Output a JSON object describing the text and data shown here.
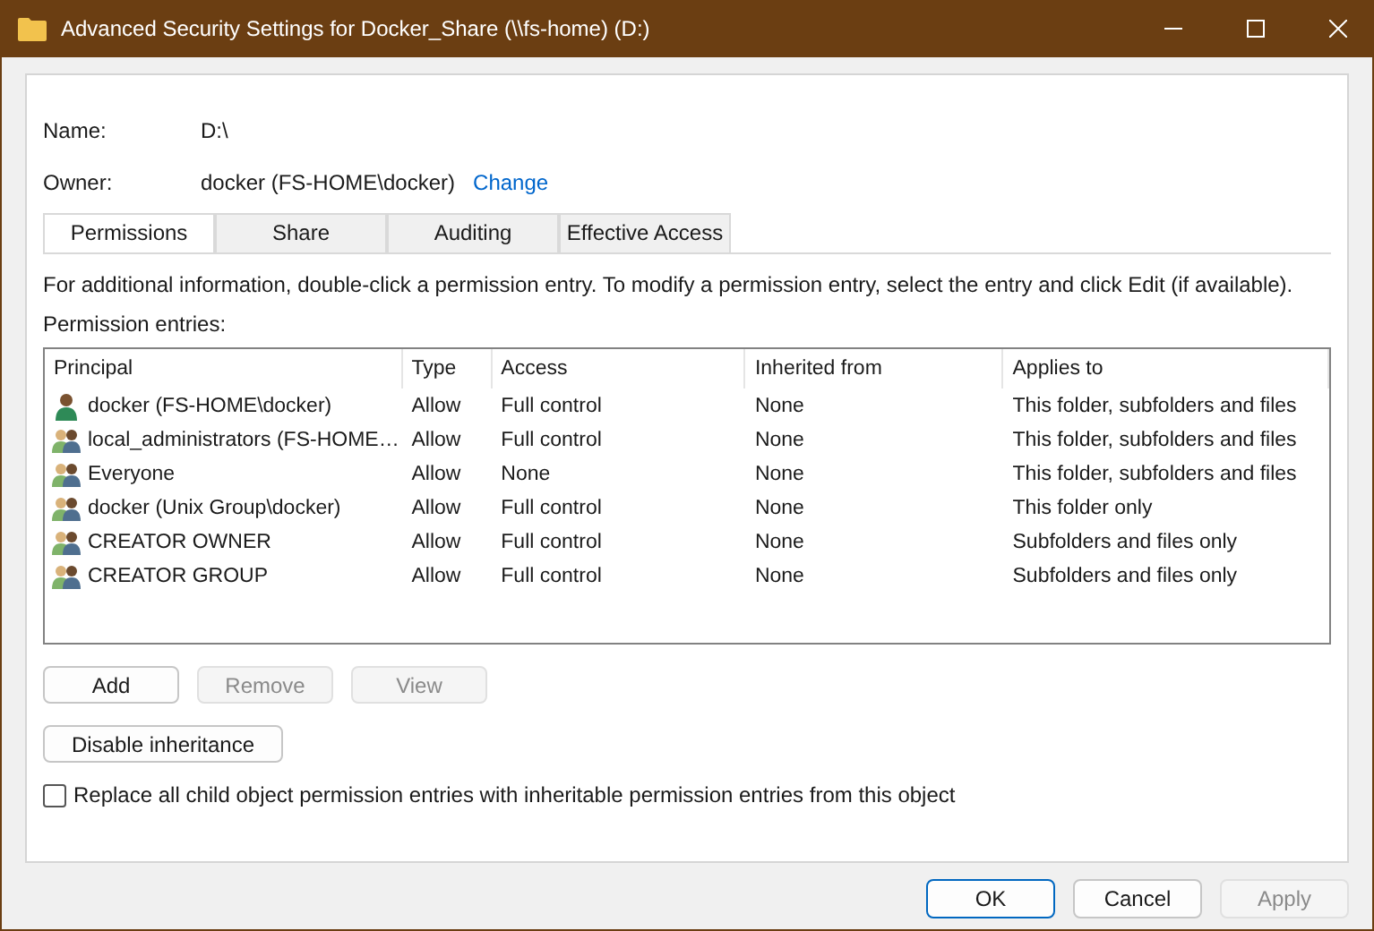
{
  "window": {
    "title": "Advanced Security Settings for Docker_Share (\\\\fs-home) (D:)"
  },
  "name": {
    "label": "Name:",
    "value": "D:\\"
  },
  "owner": {
    "label": "Owner:",
    "value": "docker (FS-HOME\\docker)",
    "link": "Change"
  },
  "tabs": [
    {
      "label": "Permissions",
      "selected": true
    },
    {
      "label": "Share",
      "selected": false
    },
    {
      "label": "Auditing",
      "selected": false
    },
    {
      "label": "Effective Access",
      "selected": false
    }
  ],
  "info": "For additional information, double-click a permission entry. To modify a permission entry, select the entry and click Edit (if available).",
  "entries_label": "Permission entries:",
  "table": {
    "columns": [
      "Principal",
      "Type",
      "Access",
      "Inherited from",
      "Applies to"
    ],
    "rows": [
      {
        "kind": "user",
        "principal": "docker (FS-HOME\\docker)",
        "type": "Allow",
        "access": "Full control",
        "inherited": "None",
        "applies": "This folder, subfolders and files"
      },
      {
        "kind": "group",
        "principal": "local_administrators (FS-HOME…",
        "type": "Allow",
        "access": "Full control",
        "inherited": "None",
        "applies": "This folder, subfolders and files"
      },
      {
        "kind": "group",
        "principal": "Everyone",
        "type": "Allow",
        "access": "None",
        "inherited": "None",
        "applies": "This folder, subfolders and files"
      },
      {
        "kind": "group",
        "principal": "docker (Unix Group\\docker)",
        "type": "Allow",
        "access": "Full control",
        "inherited": "None",
        "applies": "This folder only"
      },
      {
        "kind": "group",
        "principal": "CREATOR OWNER",
        "type": "Allow",
        "access": "Full control",
        "inherited": "None",
        "applies": "Subfolders and files only"
      },
      {
        "kind": "group",
        "principal": "CREATOR GROUP",
        "type": "Allow",
        "access": "Full control",
        "inherited": "None",
        "applies": "Subfolders and files only"
      }
    ]
  },
  "entry_buttons": [
    {
      "label": "Add",
      "disabled": false
    },
    {
      "label": "Remove",
      "disabled": true
    },
    {
      "label": "View",
      "disabled": true
    }
  ],
  "inheritance_button": {
    "label": "Disable inheritance",
    "disabled": false
  },
  "replace_checkbox": {
    "label": "Replace all child object permission entries with inheritable permission entries from this object",
    "checked": false
  },
  "footer_buttons": [
    {
      "label": "OK",
      "disabled": false,
      "default": true
    },
    {
      "label": "Cancel",
      "disabled": false,
      "default": false
    },
    {
      "label": "Apply",
      "disabled": true,
      "default": false
    }
  ]
}
